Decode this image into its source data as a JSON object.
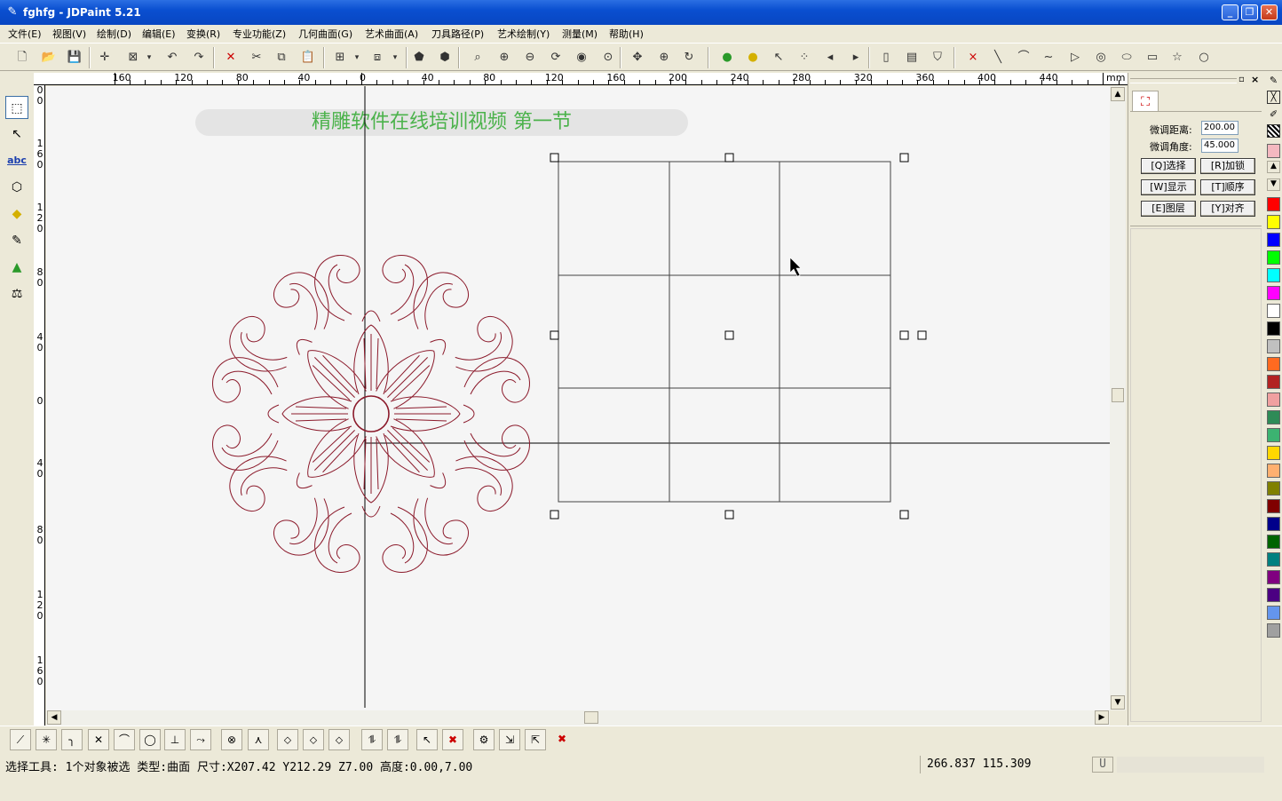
{
  "window": {
    "title": "fghfg - JDPaint 5.21",
    "minimize": "_",
    "restore": "❐",
    "close": "✕"
  },
  "menu": [
    "文件(E)",
    "视图(V)",
    "绘制(D)",
    "编辑(E)",
    "变换(R)",
    "专业功能(Z)",
    "几何曲面(G)",
    "艺术曲面(A)",
    "刀具路径(P)",
    "艺术绘制(Y)",
    "测量(M)",
    "帮助(H)"
  ],
  "toolbar_icons": [
    "new-file-icon",
    "open-folder-icon",
    "save-icon",
    "crosshair-icon",
    "select-box-icon",
    "dropdown-arrow-icon",
    "undo-icon",
    "redo-icon",
    "delete-icon",
    "cut-icon",
    "copy-icon",
    "paste-icon",
    "group-icon",
    "dropdown-arrow-icon",
    "ungroup-icon",
    "dropdown-arrow-icon",
    "shape-a-icon",
    "shape-b-icon",
    "zoom-window-icon",
    "zoom-in-icon",
    "zoom-out-icon",
    "redraw-icon",
    "view-eye-icon",
    "zoom-all-icon",
    "pan-icon",
    "zoom-icon",
    "rotate-view-icon",
    "bulb-green-icon",
    "bulb-yellow-icon",
    "select-node-icon",
    "multi-node-icon",
    "arrow-left-icon",
    "arrow-right-icon",
    "layer-icon",
    "grid-icon",
    "shield-icon",
    "point-icon",
    "line-icon",
    "arc-icon",
    "curve-icon",
    "polyline-icon",
    "circle-icon",
    "ellipse-icon",
    "rectangle-icon",
    "star-icon",
    "big-circle-icon"
  ],
  "toolbar_glyphs": [
    "🗋",
    "📂",
    "💾",
    "✛",
    "⊠",
    "▾",
    "↶",
    "↷",
    "✕",
    "✂",
    "⧉",
    "📋",
    "⊞",
    "▾",
    "⧈",
    "▾",
    "⬟",
    "⬢",
    "⌕",
    "⊕",
    "⊖",
    "⟳",
    "◉",
    "⊙",
    "✥",
    "⊕",
    "↻",
    "●",
    "●",
    "↖",
    "⁘",
    "◂",
    "▸",
    "▯",
    "▤",
    "⛉",
    "×",
    "╲",
    "⌒",
    "∼",
    "▷",
    "◎",
    "⬭",
    "▭",
    "☆",
    "○"
  ],
  "left_tools": [
    {
      "icon": "select-tool-icon",
      "glyph": "⬚"
    },
    {
      "icon": "node-edit-icon",
      "glyph": "↖"
    },
    {
      "icon": "text-tool-icon",
      "glyph": "abc"
    },
    {
      "icon": "shape-tool-icon",
      "glyph": "⬡"
    },
    {
      "icon": "fill-tool-icon",
      "glyph": "◆"
    },
    {
      "icon": "pen-tool-icon",
      "glyph": "✎"
    },
    {
      "icon": "surface-tool-icon",
      "glyph": "▲"
    },
    {
      "icon": "measure-tool-icon",
      "glyph": "⚖"
    }
  ],
  "ruler": {
    "unit": "mm",
    "h_labels": [
      "160",
      "120",
      "80",
      "40",
      "0",
      "40",
      "80",
      "120",
      "160",
      "200",
      "240",
      "280",
      "320",
      "360",
      "400",
      "440"
    ],
    "v_labels": [
      "00",
      "160",
      "120",
      "80",
      "40",
      "0",
      "40",
      "80",
      "120",
      "160"
    ]
  },
  "canvas": {
    "banner": "精雕软件在线培训视频  第一节"
  },
  "right_panel": {
    "fine_distance_label": "微调距离:",
    "fine_distance_value": "200.00",
    "fine_angle_label": "微调角度:",
    "fine_angle_value": "45.000",
    "buttons": [
      "[Q]选择",
      "[R]加锁",
      "[W]显示",
      "[T]顺序",
      "[E]图层",
      "[Y]对齐"
    ]
  },
  "palette": [
    "#ff0000",
    "#ffff00",
    "#0000ff",
    "#00ff00",
    "#00ffff",
    "#ff00ff",
    "#ffffff",
    "#000000",
    "#c0c0c0",
    "#ff6a20",
    "#b22222",
    "#f0a0a0",
    "#2e8b57",
    "#3cb371",
    "#ffd700",
    "#ffb070",
    "#808000",
    "#800000",
    "#00008b",
    "#006400",
    "#008080",
    "#800080",
    "#4b0082",
    "#6495ed",
    "#a0a0a0"
  ],
  "bottom_tools": [
    "line-tool-icon",
    "trim-icon",
    "fillet-icon",
    "cross-icon",
    "corner-icon",
    "circle-snap-icon",
    "perpendicular-icon",
    "tangent-icon",
    "intersect-icon",
    "bisect-icon",
    "node-a-icon",
    "node-b-icon",
    "node-c-icon",
    "align-a-icon",
    "align-b-icon",
    "select-x-icon",
    "select-y-icon",
    "transform-a-icon",
    "transform-b-icon",
    "transform-c-icon",
    "close-red-icon"
  ],
  "bottom_glyphs": [
    "⟋",
    "✳",
    "╮",
    "✕",
    "⌒",
    "◯",
    "⊥",
    "⤳",
    "⊗",
    "⋏",
    "⬦",
    "⬦",
    "⬦",
    "⥮",
    "⥮",
    "↖",
    "✖",
    "⚙",
    "⇲",
    "⇱",
    "✖"
  ],
  "status": {
    "left": "选择工具: 1个对象被选 类型:曲面 尺寸:X207.42 Y212.29 Z7.00 高度:0.00,7.00",
    "coords": "266.837  115.309",
    "unit_box": "U"
  }
}
